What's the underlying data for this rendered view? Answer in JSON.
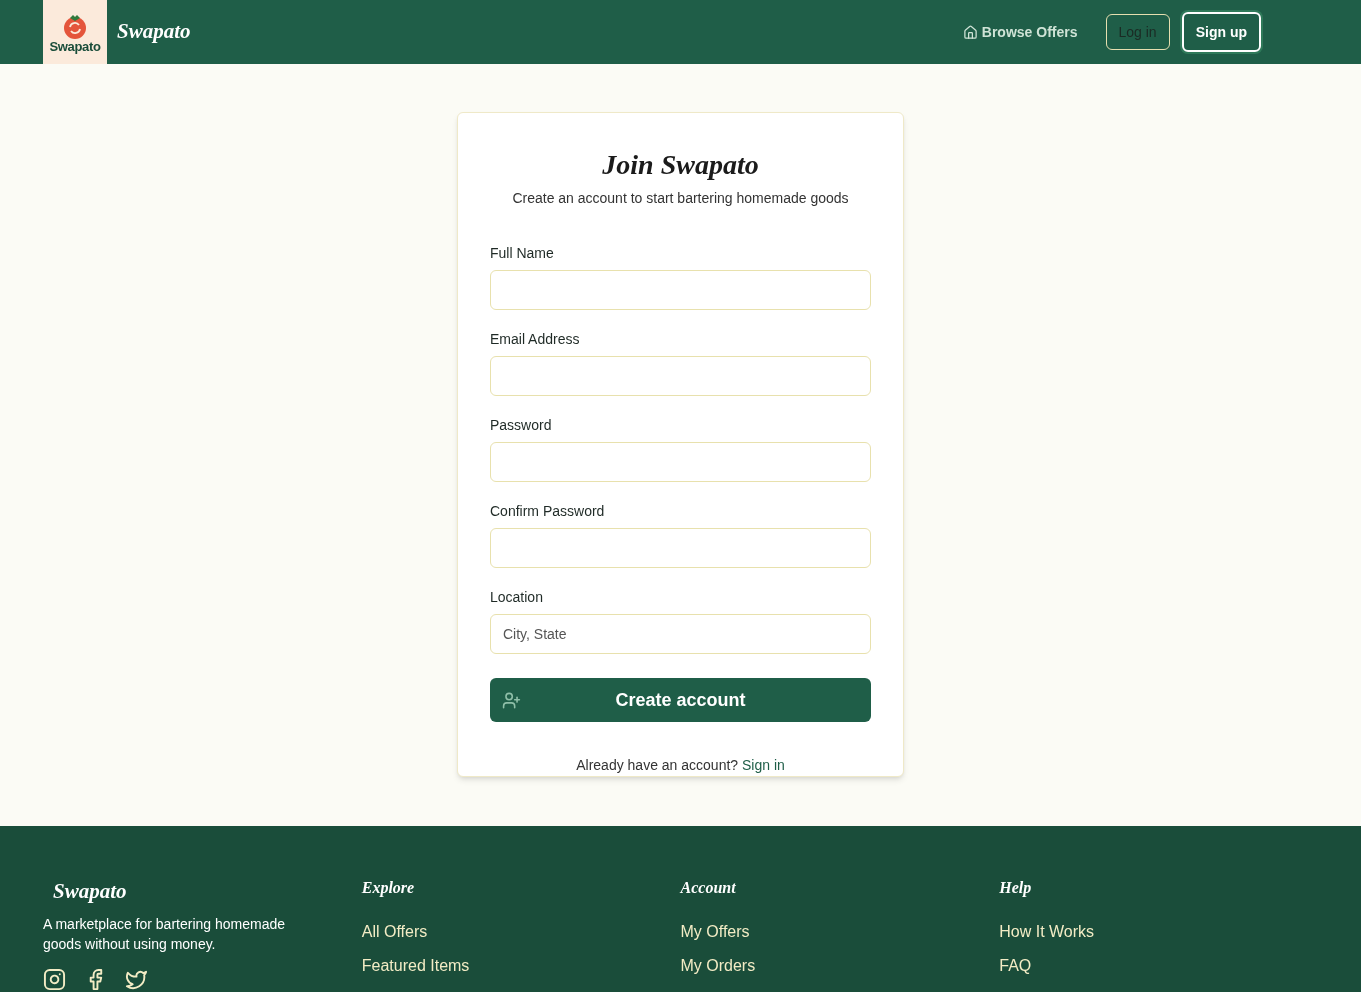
{
  "header": {
    "logo_text": "Swapato",
    "brand": "Swapato",
    "nav": [
      {
        "kind": "link",
        "label": "Browse Offers"
      },
      {
        "kind": "outline",
        "label": "Log in"
      },
      {
        "kind": "primary",
        "label": "Sign up"
      }
    ]
  },
  "form": {
    "title": "Join Swapato",
    "subtitle": "Create an account to start bartering homemade goods",
    "fields": [
      {
        "label": "Full Name"
      },
      {
        "label": "Email Address"
      },
      {
        "label": "Password"
      },
      {
        "label": "Confirm Password"
      },
      {
        "label": "Location",
        "placeholder": "City, State"
      }
    ],
    "submit": "Create account",
    "footer_text": "Already have an account?",
    "footer_link": "Sign in"
  },
  "footer": {
    "brand": "Swapato",
    "tagline": "A marketplace for bartering homemade goods without using money.",
    "columns": [
      {
        "title": "Explore",
        "links": [
          "All Offers",
          "Featured Items"
        ]
      },
      {
        "title": "Account",
        "links": [
          "My Offers",
          "My Orders"
        ]
      },
      {
        "title": "Help",
        "links": [
          "How It Works",
          "FAQ"
        ]
      }
    ]
  }
}
